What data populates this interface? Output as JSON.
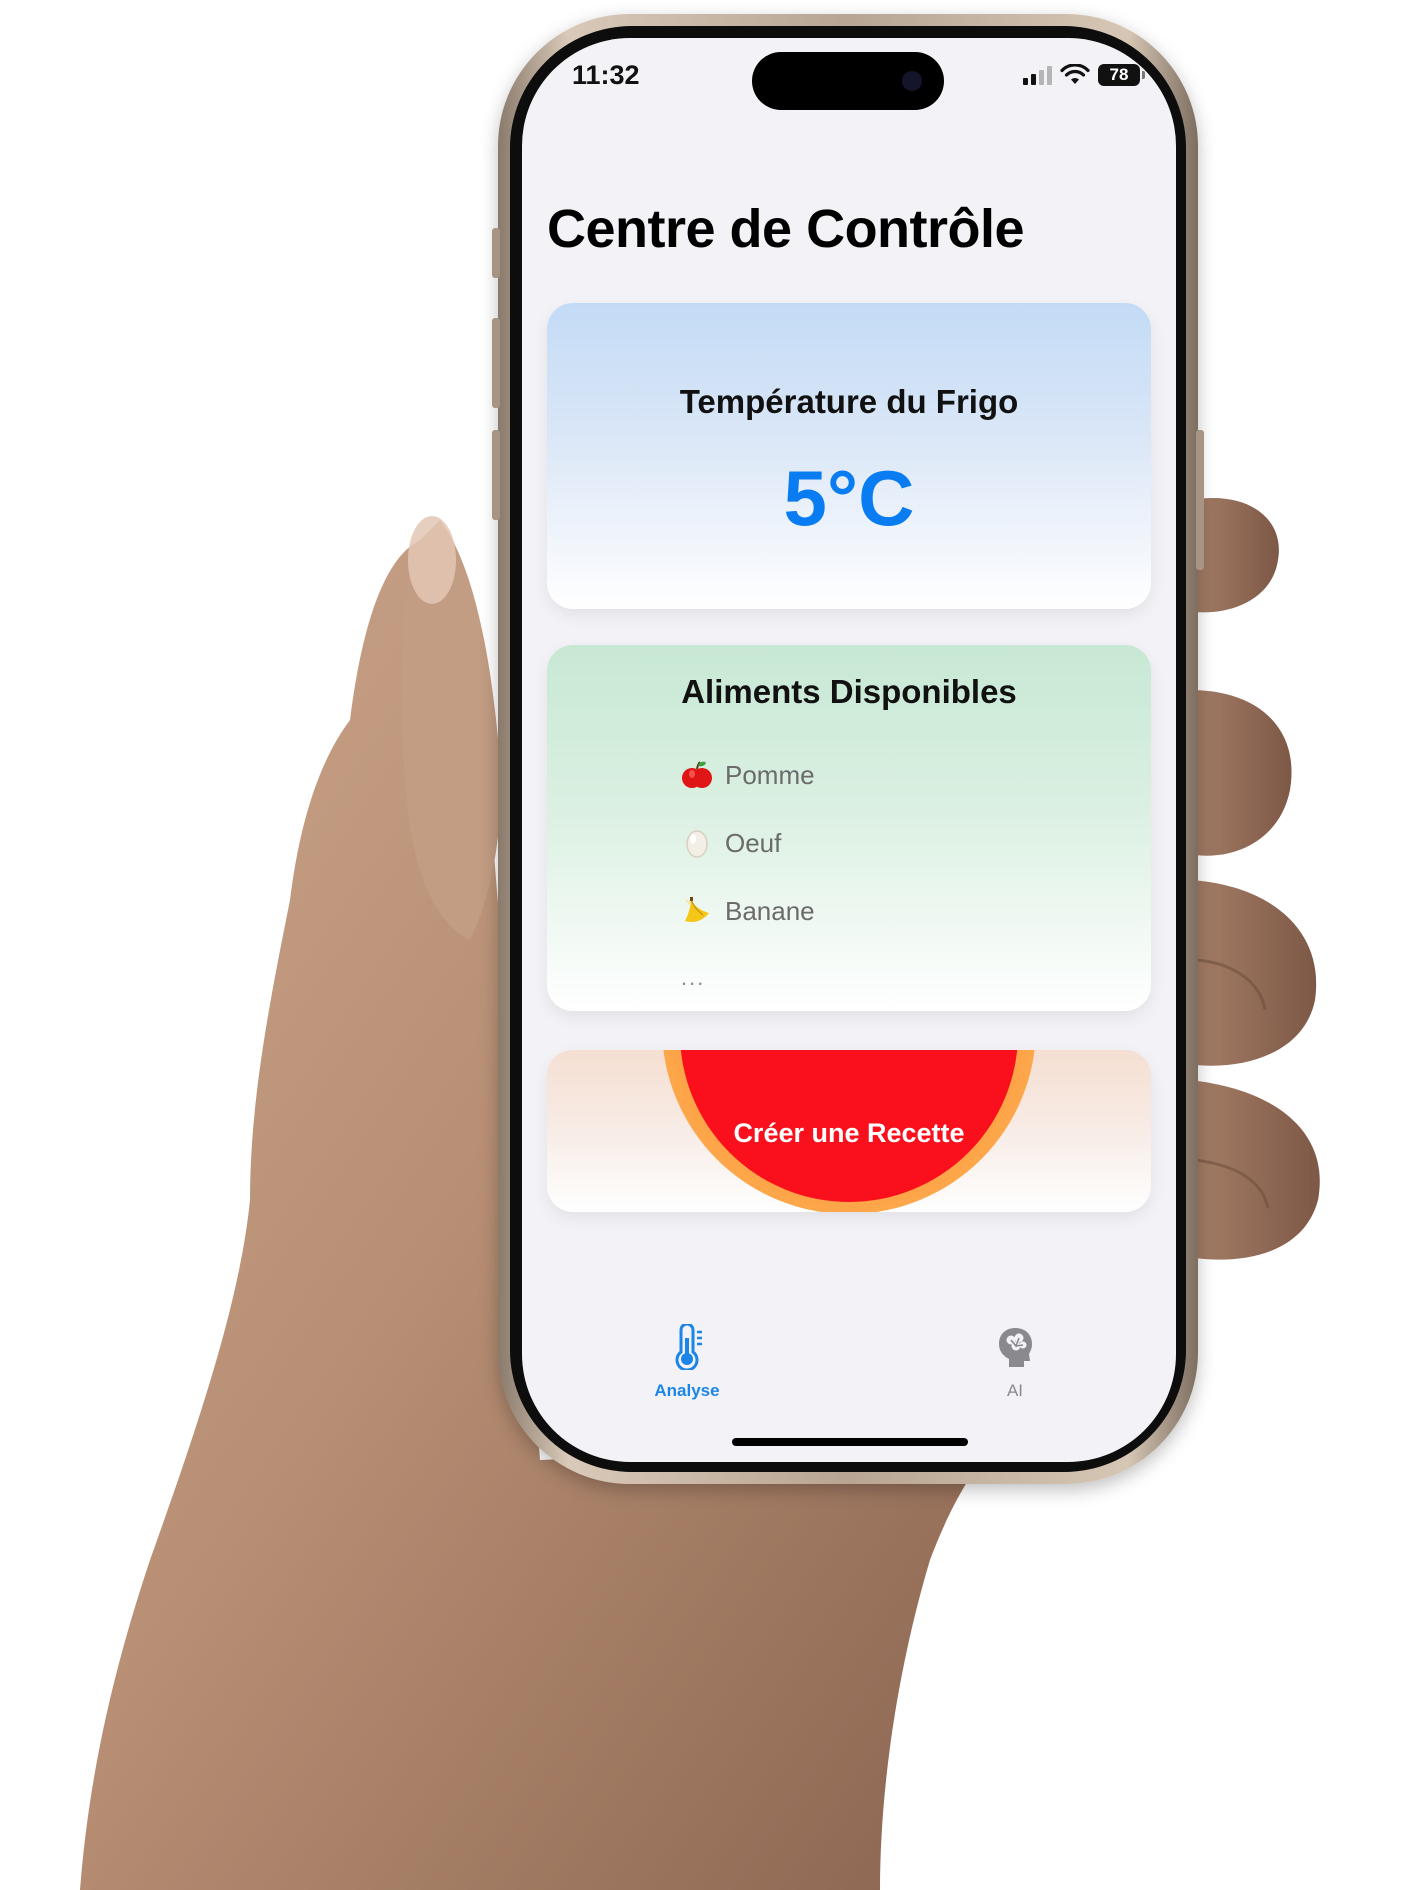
{
  "status_bar": {
    "time": "11:32",
    "battery": "78",
    "icons": [
      "signal-icon",
      "wifi-icon",
      "battery-icon"
    ]
  },
  "page": {
    "title": "Centre de Contrôle"
  },
  "temperature_card": {
    "title": "Température du Frigo",
    "value": "5°C",
    "value_color": "#0a7cf2"
  },
  "food_card": {
    "title": "Aliments Disponibles",
    "items": [
      {
        "icon": "apple-icon",
        "label": "Pomme"
      },
      {
        "icon": "egg-icon",
        "label": "Oeuf"
      },
      {
        "icon": "banana-icon",
        "label": "Banane"
      }
    ],
    "more": "..."
  },
  "recipe_card": {
    "button_label": "Créer une Recette",
    "button_color": "#fa0f1c"
  },
  "tab_bar": {
    "tabs": [
      {
        "label": "Analyse",
        "icon": "thermometer-icon",
        "selected": true
      },
      {
        "label": "AI",
        "icon": "brain-head-icon",
        "selected": false
      }
    ],
    "accent_color": "#1b86e8"
  }
}
